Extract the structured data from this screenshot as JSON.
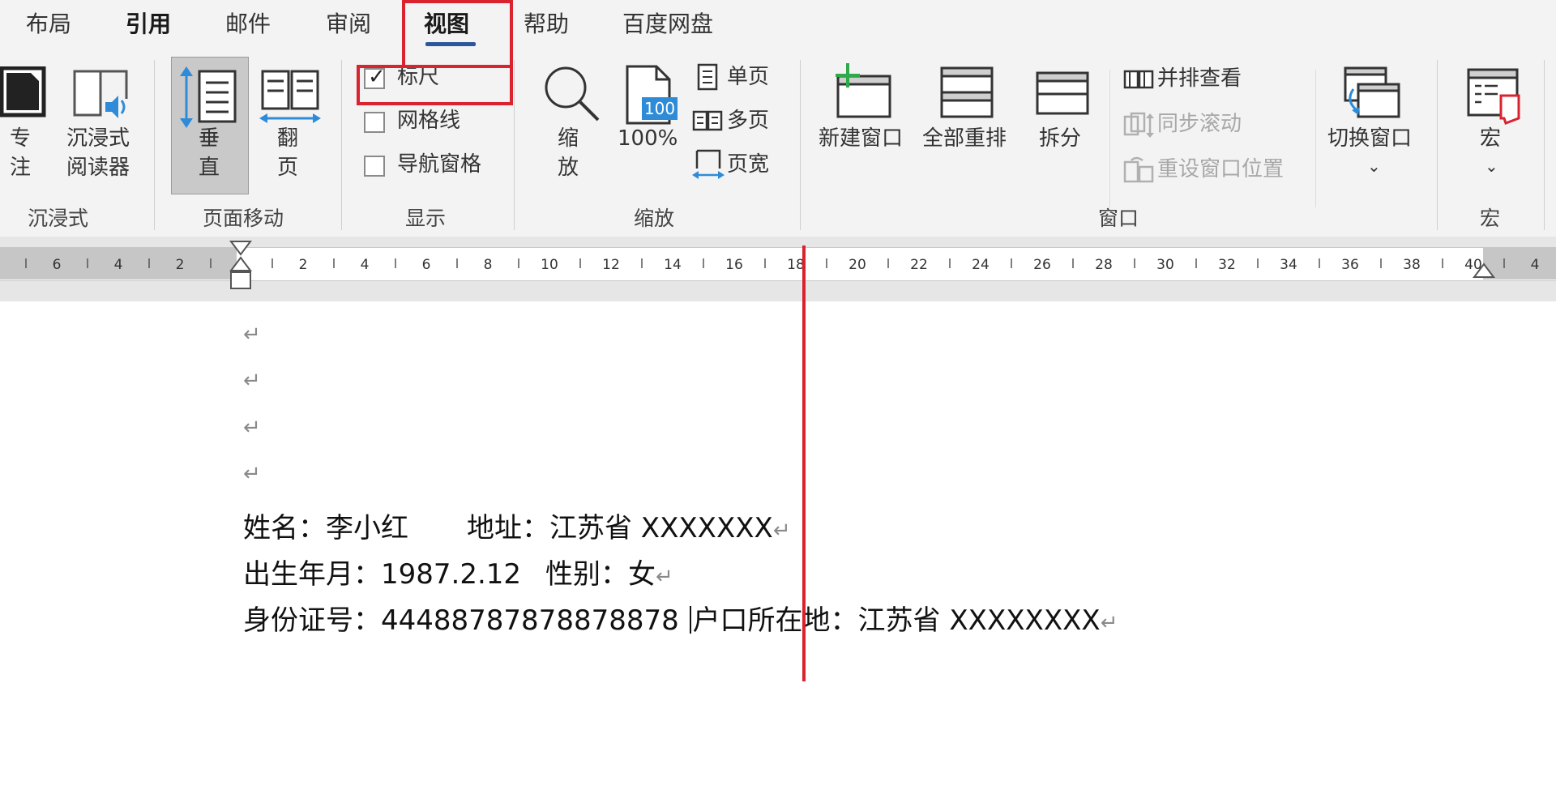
{
  "tabs": [
    {
      "label": "布局",
      "bold": false
    },
    {
      "label": "引用",
      "bold": true
    },
    {
      "label": "邮件",
      "bold": false
    },
    {
      "label": "审阅",
      "bold": false
    },
    {
      "label": "视图",
      "bold": true
    },
    {
      "label": "帮助",
      "bold": false
    },
    {
      "label": "百度网盘",
      "bold": false
    }
  ],
  "ribbon": {
    "immersive": {
      "focus_label_1": "专",
      "focus_label_2": "注",
      "reader_label_1": "沉浸式",
      "reader_label_2": "阅读器",
      "group_label": "沉浸式"
    },
    "page_movement": {
      "vertical_label_1": "垂",
      "vertical_label_2": "直",
      "flip_label_1": "翻",
      "flip_label_2": "页",
      "group_label": "页面移动"
    },
    "show": {
      "ruler_label": "标尺",
      "ruler_checked": true,
      "gridlines_label": "网格线",
      "gridlines_checked": false,
      "nav_pane_label": "导航窗格",
      "nav_pane_checked": false,
      "group_label": "显示"
    },
    "zoom": {
      "zoom_label_1": "缩",
      "zoom_label_2": "放",
      "zoom100_label": "100%",
      "zoom100_badge": "100",
      "one_page_label": "单页",
      "multi_page_label": "多页",
      "page_width_label": "页宽",
      "group_label": "缩放"
    },
    "window": {
      "new_window_label": "新建窗口",
      "arrange_all_label": "全部重排",
      "split_label": "拆分",
      "side_by_side_label": "并排查看",
      "sync_scroll_label": "同步滚动",
      "reset_position_label": "重设窗口位置",
      "switch_window_label": "切换窗口",
      "group_label": "窗口"
    },
    "macros": {
      "macros_label": "宏",
      "group_label": "宏"
    }
  },
  "ruler": {
    "labels": [
      "6",
      "4",
      "2",
      "2",
      "4",
      "6",
      "8",
      "10",
      "12",
      "14",
      "16",
      "18",
      "20",
      "22",
      "24",
      "26",
      "28",
      "30",
      "32",
      "34",
      "36",
      "38",
      "40",
      "4"
    ]
  },
  "document": {
    "line1_name": "姓名：李小红",
    "line1_address": "地址：江苏省 XXXXXXX",
    "line2_birth": "出生年月：1987.2.12",
    "line2_gender": "性别：女",
    "line3_id": "身份证号：44488787878878878",
    "line3_household": "户口所在地：江苏省 XXXXXXXX",
    "paragraph_mark": "↵"
  },
  "colors": {
    "accent": "#2b579a",
    "annotation": "#d9232e",
    "ribbon_bg": "#f3f3f3",
    "icon_blue": "#2e8bd8"
  }
}
